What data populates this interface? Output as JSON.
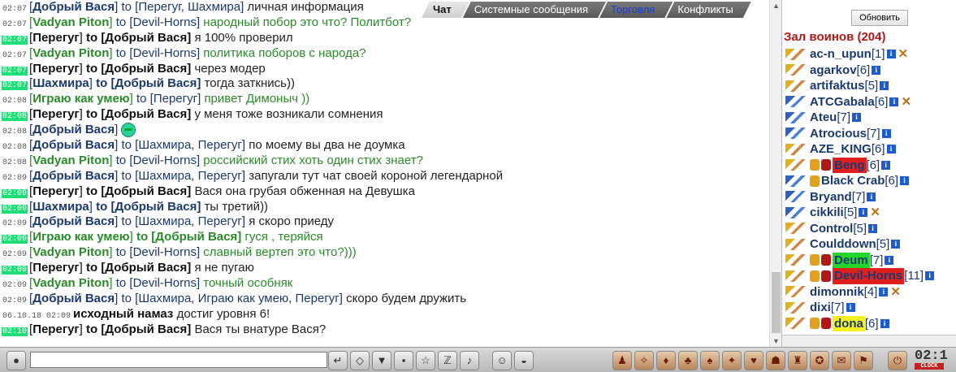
{
  "tabs": [
    {
      "label": "Чат",
      "active": true
    },
    {
      "label": "Системные сообщения",
      "active": false
    },
    {
      "label": "Торговля",
      "active": false,
      "color": "#1a40d0"
    },
    {
      "label": "Конфликты",
      "active": false
    }
  ],
  "chat": {
    "lines": [
      {
        "time": "02:07",
        "hl": false,
        "kind": "normal",
        "sender": "Добрый Вася",
        "to": "Перегуг, Шахмира",
        "text": "личная информация"
      },
      {
        "time": "02:07",
        "hl": false,
        "kind": "green",
        "sender": "Vadyan Piton",
        "to": "Devil-Horns",
        "text": "народный побор это что? Политбот?"
      },
      {
        "time": "02:07",
        "hl": true,
        "kind": "me",
        "sender": "Перегуг",
        "to": "Добрый Вася",
        "text": "я 100% проверил"
      },
      {
        "time": "02:07",
        "hl": false,
        "kind": "green",
        "sender": "Vadyan Piton",
        "to": "Devil-Horns",
        "text": "политика поборов с народа?"
      },
      {
        "time": "02:07",
        "hl": true,
        "kind": "me",
        "sender": "Перегуг",
        "to": "Добрый Вася",
        "text": "через модер"
      },
      {
        "time": "02:07",
        "hl": true,
        "kind": "normal",
        "sender": "Шахмира",
        "to": "Добрый Вася",
        "text": "тогда заткнись))"
      },
      {
        "time": "02:08",
        "hl": false,
        "kind": "green",
        "sender": "Играю как умею",
        "to": "Перегуг",
        "text": "привет Димоныч ))"
      },
      {
        "time": "02:08",
        "hl": true,
        "kind": "me",
        "sender": "Перегуг",
        "to": "Добрый Вася",
        "text": "у меня тоже возникали сомнения"
      },
      {
        "time": "02:08",
        "hl": false,
        "kind": "solo",
        "sender": "Добрый Вася",
        "to": "",
        "text": ""
      },
      {
        "time": "02:08",
        "hl": false,
        "kind": "normal",
        "sender": "Добрый Вася",
        "to": "Шахмира, Перегуг",
        "text": "по моему вы два не доумка"
      },
      {
        "time": "02:08",
        "hl": false,
        "kind": "green",
        "sender": "Vadyan Piton",
        "to": "Devil-Horns",
        "text": "российский стих хоть один стих знает?"
      },
      {
        "time": "02:09",
        "hl": false,
        "kind": "normal",
        "sender": "Добрый Вася",
        "to": "Шахмира, Перегуг",
        "text": "запугали тут чат своей короной легендарной"
      },
      {
        "time": "02:09",
        "hl": true,
        "kind": "me",
        "sender": "Перегуг",
        "to": "Добрый Вася",
        "text": "Вася она грубая обженная на Девушка"
      },
      {
        "time": "02:09",
        "hl": true,
        "kind": "normal",
        "sender": "Шахмира",
        "to": "Добрый Вася",
        "text": "ты третий))"
      },
      {
        "time": "02:09",
        "hl": false,
        "kind": "normal",
        "sender": "Добрый Вася",
        "to": "Шахмира, Перегуг",
        "text": "я скоро приеду"
      },
      {
        "time": "02:09",
        "hl": true,
        "kind": "green",
        "sender": "Играю как умею",
        "to": "Добрый Вася",
        "text": "гуся , теряйся"
      },
      {
        "time": "02:09",
        "hl": false,
        "kind": "green",
        "sender": "Vadyan Piton",
        "to": "Devil-Horns",
        "text": "славный вертеп это что?)))"
      },
      {
        "time": "02:09",
        "hl": true,
        "kind": "me",
        "sender": "Перегуг",
        "to": "Добрый Вася",
        "text": "я не пугаю"
      },
      {
        "time": "02:09",
        "hl": false,
        "kind": "green",
        "sender": "Vadyan Piton",
        "to": "Devil-Horns",
        "text": "точный особняк"
      },
      {
        "time": "02:09",
        "hl": false,
        "kind": "normal",
        "sender": "Добрый Вася",
        "to": "Шахмира, Играю как умею, Перегуг",
        "text": "скоро будем дружить"
      },
      {
        "time": "06.10.18 02:09",
        "hl": false,
        "kind": "sys",
        "sender": "исходный намаз",
        "to": "",
        "text": "достиг уровня 6!"
      },
      {
        "time": "02:10",
        "hl": true,
        "kind": "me",
        "sender": "Перегуг",
        "to": "Добрый Вася",
        "text": "Вася ты внатуре Вася?"
      }
    ]
  },
  "sidebar": {
    "refresh_label": "Обновить",
    "room_title": "Зал воинов (204)",
    "users": [
      {
        "name": "ac-n_upun",
        "level": "[1]",
        "align": "y",
        "x": true,
        "hl": ""
      },
      {
        "name": "agarkov",
        "level": "[6]",
        "align": "y",
        "x": false,
        "hl": ""
      },
      {
        "name": "artifaktus",
        "level": "[5]",
        "align": "y",
        "x": false,
        "hl": ""
      },
      {
        "name": "ATCGabala",
        "level": "[6]",
        "align": "b",
        "x": true,
        "hl": ""
      },
      {
        "name": "Ateu",
        "level": "[7]",
        "align": "b",
        "x": false,
        "hl": ""
      },
      {
        "name": "Atrocious",
        "level": "[7]",
        "align": "b",
        "x": false,
        "hl": ""
      },
      {
        "name": "AZE_KING",
        "level": "[6]",
        "align": "y",
        "x": false,
        "hl": ""
      },
      {
        "name": "Beng",
        "level": "[6]",
        "align": "y",
        "x": false,
        "hl": "red",
        "extra": 2
      },
      {
        "name": "Black Crab",
        "level": "[6]",
        "align": "b",
        "x": false,
        "hl": "",
        "extra": 1
      },
      {
        "name": "Bryand",
        "level": "[7]",
        "align": "b",
        "x": false,
        "hl": ""
      },
      {
        "name": "cikkili",
        "level": "[5]",
        "align": "b",
        "x": true,
        "hl": ""
      },
      {
        "name": "Control",
        "level": "[5]",
        "align": "y",
        "x": false,
        "hl": ""
      },
      {
        "name": "Coulddown",
        "level": "[5]",
        "align": "y",
        "x": false,
        "hl": ""
      },
      {
        "name": "Deum",
        "level": "[7]",
        "align": "y",
        "x": false,
        "hl": "green",
        "extra": 2
      },
      {
        "name": "Devil-Horns",
        "level": "[11]",
        "align": "y",
        "x": false,
        "hl": "red",
        "extra": 2
      },
      {
        "name": "dimonnik",
        "level": "[4]",
        "align": "y",
        "x": true,
        "hl": ""
      },
      {
        "name": "dixi",
        "level": "[7]",
        "align": "y",
        "x": false,
        "hl": ""
      },
      {
        "name": "dona",
        "level": "[6]",
        "align": "y",
        "x": false,
        "hl": "yel",
        "extra": 2
      }
    ]
  },
  "toolbar": {
    "clock_time": "02:1",
    "clock_label": "CLOCK"
  }
}
